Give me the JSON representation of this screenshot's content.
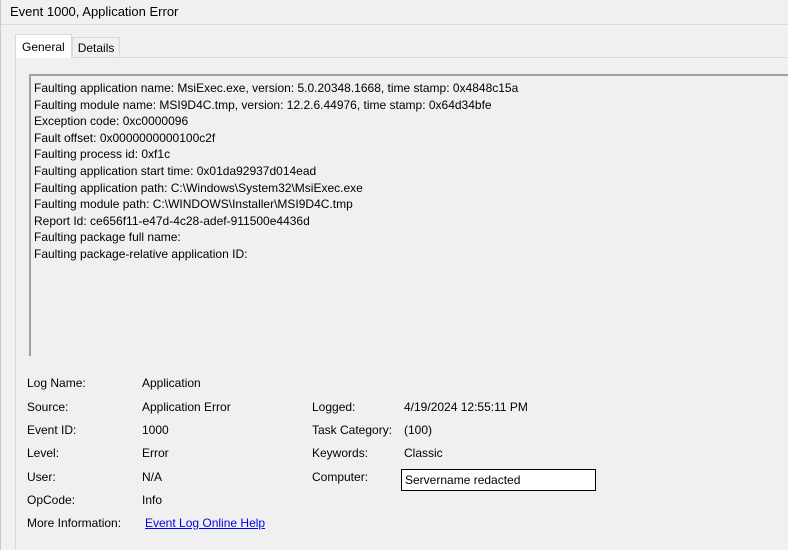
{
  "window": {
    "title": "Event 1000, Application Error"
  },
  "tabs": [
    {
      "label": "General",
      "active": true
    },
    {
      "label": "Details",
      "active": false
    }
  ],
  "description": {
    "lines": [
      "Faulting application name: MsiExec.exe, version: 5.0.20348.1668, time stamp: 0x4848c15a",
      "Faulting module name: MSI9D4C.tmp, version: 12.2.6.44976, time stamp: 0x64d34bfe",
      "Exception code: 0xc0000096",
      "Fault offset: 0x0000000000100c2f",
      "Faulting process id: 0xf1c",
      "Faulting application start time: 0x01da92937d014ead",
      "Faulting application path: C:\\Windows\\System32\\MsiExec.exe",
      "Faulting module path: C:\\WINDOWS\\Installer\\MSI9D4C.tmp",
      "Report Id: ce656f11-e47d-4c28-adef-911500e4436d",
      "Faulting package full name:",
      "Faulting package-relative application ID:"
    ]
  },
  "details": {
    "log_name_label": "Log Name:",
    "log_name_value": "Application",
    "source_label": "Source:",
    "source_value": "Application Error",
    "logged_label": "Logged:",
    "logged_value": "4/19/2024 12:55:11 PM",
    "event_id_label": "Event ID:",
    "event_id_value": "1000",
    "task_category_label": "Task Category:",
    "task_category_value": "(100)",
    "level_label": "Level:",
    "level_value": "Error",
    "keywords_label": "Keywords:",
    "keywords_value": "Classic",
    "user_label": "User:",
    "user_value": "N/A",
    "computer_label": "Computer:",
    "computer_value": "Servername redacted",
    "opcode_label": "OpCode:",
    "opcode_value": "Info",
    "more_info_label": "More Information:",
    "more_info_link": "Event Log Online Help"
  }
}
